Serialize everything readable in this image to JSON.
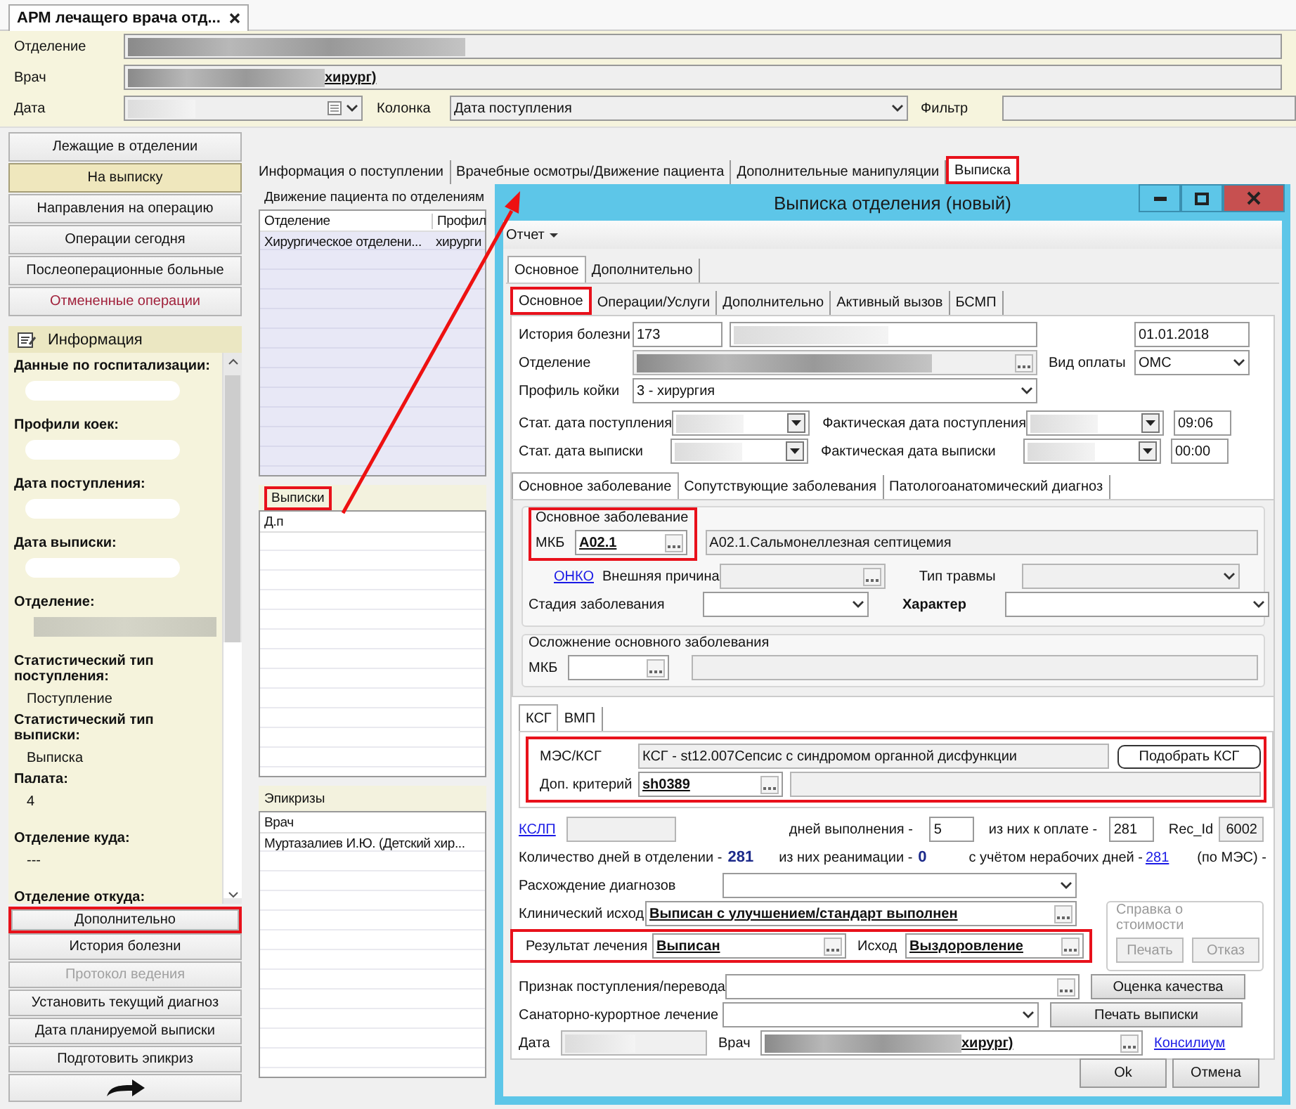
{
  "app_tab": {
    "title": "АРМ лечащего врача отд..."
  },
  "filters": {
    "department_label": "Отделение",
    "doctor_label": "Врач",
    "doctor_tail": "хирург)",
    "date_label": "Дата",
    "column_label": "Колонка",
    "column_value": "Дата поступления",
    "filter_label": "Фильтр"
  },
  "nav_buttons": [
    {
      "label": "Лежащие в отделении",
      "selected": false,
      "kind": "normal"
    },
    {
      "label": "На выписку",
      "selected": true,
      "kind": "normal"
    },
    {
      "label": "Направления на операцию",
      "selected": false,
      "kind": "normal"
    },
    {
      "label": "Операции сегодня",
      "selected": false,
      "kind": "normal"
    },
    {
      "label": "Послеоперационные больные",
      "selected": false,
      "kind": "normal"
    },
    {
      "label": "Отмененные операции",
      "selected": false,
      "kind": "alert"
    }
  ],
  "info": {
    "title": "Информация",
    "sections": [
      {
        "label": "Данные по госпитализации:",
        "kind": "blur"
      },
      {
        "label": "Профили коек:",
        "kind": "blur"
      },
      {
        "label": "Дата поступления:",
        "kind": "blur"
      },
      {
        "label": "Дата выписки:",
        "kind": "blur"
      },
      {
        "label": "Отделение:",
        "kind": "bar"
      },
      {
        "label": "Статистический тип поступления:",
        "kind": "text",
        "value": "Поступление"
      },
      {
        "label": "Статистический тип выписки:",
        "kind": "text",
        "value": "Выписка"
      },
      {
        "label": "Палата:",
        "kind": "text",
        "value": "4"
      },
      {
        "label": "Отделение куда:",
        "kind": "text",
        "value": "---"
      },
      {
        "label": "Отделение откуда:",
        "kind": "text"
      }
    ]
  },
  "action_buttons": [
    {
      "label": "Дополнительно",
      "disabled": false,
      "highlighted": true
    },
    {
      "label": "История болезни",
      "disabled": false,
      "highlighted": false
    },
    {
      "label": "Протокол ведения",
      "disabled": true,
      "highlighted": false
    },
    {
      "label": "Установить текущий диагноз",
      "disabled": false,
      "highlighted": false
    },
    {
      "label": "Дата планируемой выписки",
      "disabled": false,
      "highlighted": false
    },
    {
      "label": "Подготовить эпикриз",
      "disabled": false,
      "highlighted": false
    }
  ],
  "main_tabs": [
    {
      "label": "Информация о поступлении",
      "selected": false,
      "highlighted": false
    },
    {
      "label": "Врачебные осмотры/Движение пациента",
      "selected": false,
      "highlighted": false
    },
    {
      "label": "Дополнительные манипуляции",
      "selected": false,
      "highlighted": false
    },
    {
      "label": "Выписка",
      "selected": true,
      "highlighted": true
    }
  ],
  "movement": {
    "title": "Движение пациента по отделениям",
    "highlighted": false,
    "columns": [
      "Отделение",
      "Профил"
    ],
    "rows": [
      [
        "Хирургическое отделени...",
        "хирурги"
      ]
    ]
  },
  "discharges": {
    "title": "Выписки",
    "highlighted": true,
    "columns": [
      "Д.п"
    ]
  },
  "epicrises": {
    "title": "Эпикризы",
    "highlighted": false,
    "columns": [
      "Врач"
    ],
    "rows": [
      [
        "Муртазалиев И.Ю. (Детский хир..."
      ]
    ]
  },
  "dialog": {
    "title": "Выписка отделения (новый)",
    "menu": "Отчет",
    "outer_tabs": [
      {
        "label": "Основное",
        "selected": true
      },
      {
        "label": "Дополнительно",
        "selected": false
      }
    ],
    "inner_tabs": [
      {
        "label": "Основное",
        "selected": true,
        "highlighted": true
      },
      {
        "label": "Операции/Услуги",
        "selected": false,
        "highlighted": false
      },
      {
        "label": "Дополнительно",
        "selected": false,
        "highlighted": false
      },
      {
        "label": "Активный вызов",
        "selected": false,
        "highlighted": false
      },
      {
        "label": "БСМП",
        "selected": false,
        "highlighted": false
      }
    ],
    "history_label": "История болезни",
    "history_number": "173",
    "history_date": "01.01.2018",
    "department_label": "Отделение",
    "payment_label": "Вид оплаты",
    "payment_value": "ОМС",
    "bed_profile_label": "Профиль койки",
    "bed_profile_value": "3 - хирургия",
    "stat_admission_label": "Стат. дата поступления",
    "actual_admission_label": "Фактическая дата поступления",
    "admission_time": "09:06",
    "stat_discharge_label": "Стат. дата выписки",
    "actual_discharge_label": "Фактическая дата выписки",
    "discharge_time": "00:00",
    "diagnosis_tabs": [
      {
        "label": "Основное заболевание",
        "selected": true
      },
      {
        "label": "Сопутствующие заболевания",
        "selected": false
      },
      {
        "label": "Патологоанатомический диагноз",
        "selected": false
      }
    ],
    "main_disease": {
      "legend": "Основное заболевание",
      "highlighted": true,
      "mkb_label": "МКБ",
      "mkb_code": "A02.1",
      "mkb_name": "A02.1.Сальмонеллезная септицемия",
      "onko_link": "ОНКО",
      "external_cause_label": "Внешняя причина",
      "trauma_label": "Тип травмы",
      "stage_label": "Стадия заболевания",
      "character_label": "Характер"
    },
    "complication": {
      "legend": "Осложнение основного заболевания",
      "mkb_label": "МКБ"
    },
    "ksg_tabs": [
      {
        "label": "КСГ",
        "selected": true
      },
      {
        "label": "ВМП",
        "selected": false
      }
    ],
    "ksg": {
      "highlighted": true,
      "mes_label": "МЭС/КСГ",
      "mes_value": "КСГ - st12.007Сепсис с синдромом органной дисфункции",
      "pick_button": "Подобрать КСГ",
      "criterion_label": "Доп. критерий",
      "criterion_value": "sh0389"
    },
    "kslp_link": "КСЛП",
    "days_done_label": "дней выполнения -",
    "days_done": "5",
    "to_pay_label": "из них к оплате -",
    "to_pay": "281",
    "rec_id_label": "Rec_Id",
    "rec_id": "6002",
    "days_in_dept_label": "Количество дней в отделении -",
    "days_in_dept": "281",
    "icu_label": "из них реанимации -",
    "icu": "0",
    "non_working_label": "с учётом нерабочих дней -",
    "non_working": "281",
    "mes_note": "(по МЭС) -",
    "divergence_label": "Расхождение диагнозов",
    "clinical_outcome_label": "Клинический исход",
    "clinical_outcome": "Выписан с улучшением/стандарт выполнен",
    "cost": {
      "legend": "Справка о стоимости",
      "disabled": true,
      "buttons": [
        "Печать",
        "Отказ"
      ]
    },
    "result": {
      "highlighted": true,
      "label": "Результат лечения",
      "value": "Выписан",
      "outcome_label": "Исход",
      "outcome_value": "Выздоровление"
    },
    "admission_sign_label": "Признак поступления/перевода",
    "quality_button": "Оценка качества",
    "sanatorium_label": "Санаторно-курортное лечение",
    "print_discharge_button": "Печать выписки",
    "date_label": "Дата",
    "doctor_label": "Врач",
    "doctor_tail": "хирург)",
    "consilium_link": "Консилиум",
    "ok_button": "Ok",
    "cancel_button": "Отмена"
  }
}
